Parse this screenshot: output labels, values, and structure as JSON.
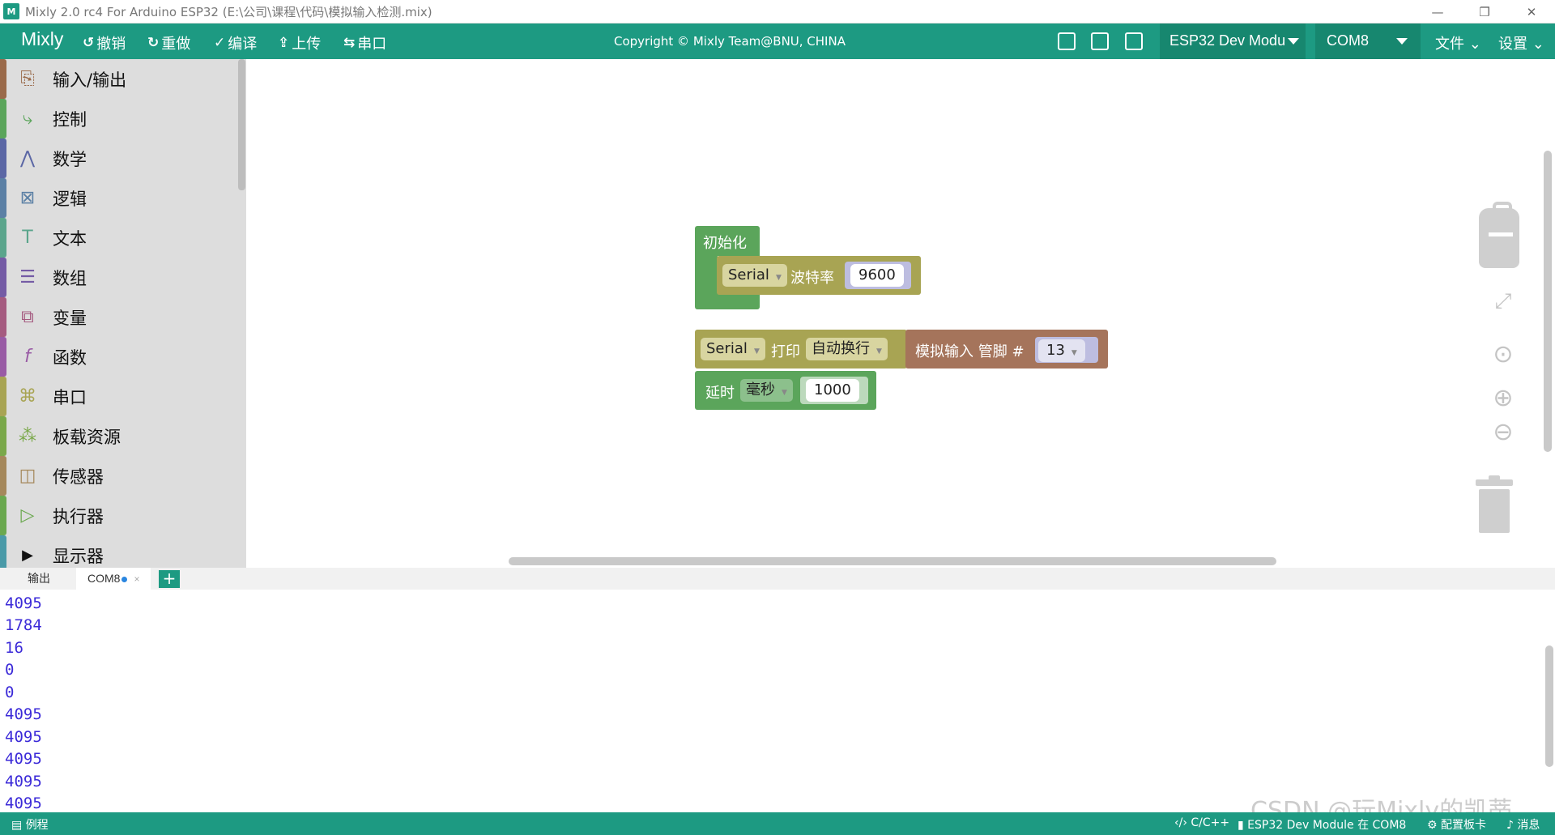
{
  "window": {
    "title": "Mixly 2.0 rc4 For Arduino ESP32 (E:\\公司\\课程\\代码\\模拟输入检测.mix)",
    "app_icon_text": "M",
    "minimize": "—",
    "restore": "❐",
    "close": "✕"
  },
  "toolbar": {
    "brand": "Mixly",
    "undo_label": "撤销",
    "redo_label": "重做",
    "compile_label": "编译",
    "upload_label": "上传",
    "serial_label": "串口",
    "copyright": "Copyright © Mixly Team@BNU, CHINA",
    "board": "ESP32 Dev Modu",
    "port": "COM8",
    "file_menu": "文件",
    "settings_menu": "设置",
    "accent_color": "#1d9a82"
  },
  "sidebar": {
    "items": [
      {
        "label": "输入/输出",
        "icon": "io-icon",
        "color": "#9a6a4a"
      },
      {
        "label": "控制",
        "icon": "control-icon",
        "color": "#5ba55b"
      },
      {
        "label": "数学",
        "icon": "math-icon",
        "color": "#5b67a5"
      },
      {
        "label": "逻辑",
        "icon": "logic-icon",
        "color": "#5b80a5"
      },
      {
        "label": "文本",
        "icon": "text-icon",
        "color": "#5ba58c"
      },
      {
        "label": "数组",
        "icon": "list-icon",
        "color": "#745ba5"
      },
      {
        "label": "变量",
        "icon": "variable-icon",
        "color": "#a55b80"
      },
      {
        "label": "函数",
        "icon": "function-icon",
        "color": "#995ba5"
      },
      {
        "label": "串口",
        "icon": "serial-icon",
        "color": "#a8a453"
      },
      {
        "label": "板载资源",
        "icon": "board-icon",
        "color": "#7aa84a"
      },
      {
        "label": "传感器",
        "icon": "sensor-icon",
        "color": "#a5885b"
      },
      {
        "label": "执行器",
        "icon": "actuator-icon",
        "color": "#6aa84f"
      },
      {
        "label": "显示器",
        "icon": "display-icon",
        "color": "#4a9aa8"
      }
    ]
  },
  "blocks": {
    "init_label": "初始化",
    "serial_dropdown": "Serial",
    "baud_label": "波特率",
    "baud_value": "9600",
    "print_serial": "Serial",
    "print_label": "打印",
    "print_mode": "自动换行",
    "analog_label": "模拟输入 管脚 #",
    "pin_value": "13",
    "delay_label": "延时",
    "delay_unit": "毫秒",
    "delay_value": "1000"
  },
  "tabs": {
    "output": "输出",
    "com": "COM8",
    "close": "×",
    "add": "+"
  },
  "console": {
    "lines": [
      "4095",
      "1784",
      "16",
      "0",
      "0",
      "4095",
      "4095",
      "4095",
      "4095",
      "4095"
    ]
  },
  "watermark": "CSDN @玩Mixly的凯蒂",
  "statusbar": {
    "examples": "例程",
    "language": "C/C++",
    "board_status": "ESP32 Dev Module 在 COM8",
    "config": "配置板卡",
    "messages": "消息"
  }
}
